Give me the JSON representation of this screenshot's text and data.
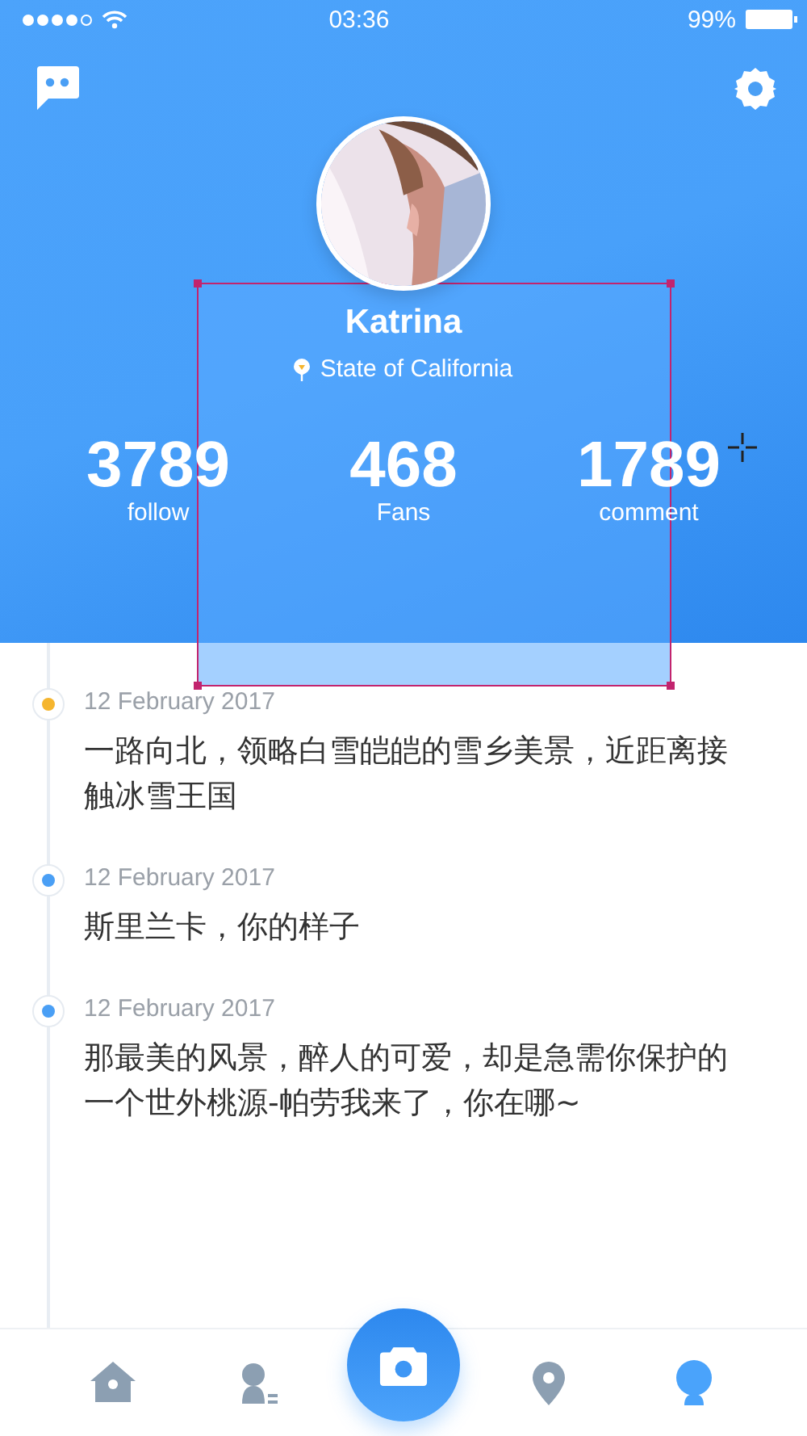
{
  "status_bar": {
    "time": "03:36",
    "battery": "99%"
  },
  "profile": {
    "name": "Katrina",
    "location": "State of California"
  },
  "stats": [
    {
      "value": "3789",
      "label": "follow"
    },
    {
      "value": "468",
      "label": "Fans"
    },
    {
      "value": "1789",
      "label": "comment"
    }
  ],
  "timeline": [
    {
      "date": "12 February 2017",
      "text": "一路向北，领略白雪皑皑的雪乡美景，近距离接触冰雪王国",
      "color": "#f5b52e"
    },
    {
      "date": "12 February 2017",
      "text": "斯里兰卡，你的样子",
      "color": "#4a9ff5"
    },
    {
      "date": "12 February 2017",
      "text": "那最美的风景，醉人的可爱，却是急需你保护的一个世外桃源-帕劳我来了，你在哪~",
      "color": "#4a9ff5"
    }
  ],
  "tab_bar": [
    {
      "kind": "home",
      "selected": false
    },
    {
      "kind": "contacts",
      "selected": false
    },
    {
      "kind": "camera",
      "selected": false
    },
    {
      "kind": "location",
      "selected": false
    },
    {
      "kind": "profile",
      "selected": true
    }
  ]
}
